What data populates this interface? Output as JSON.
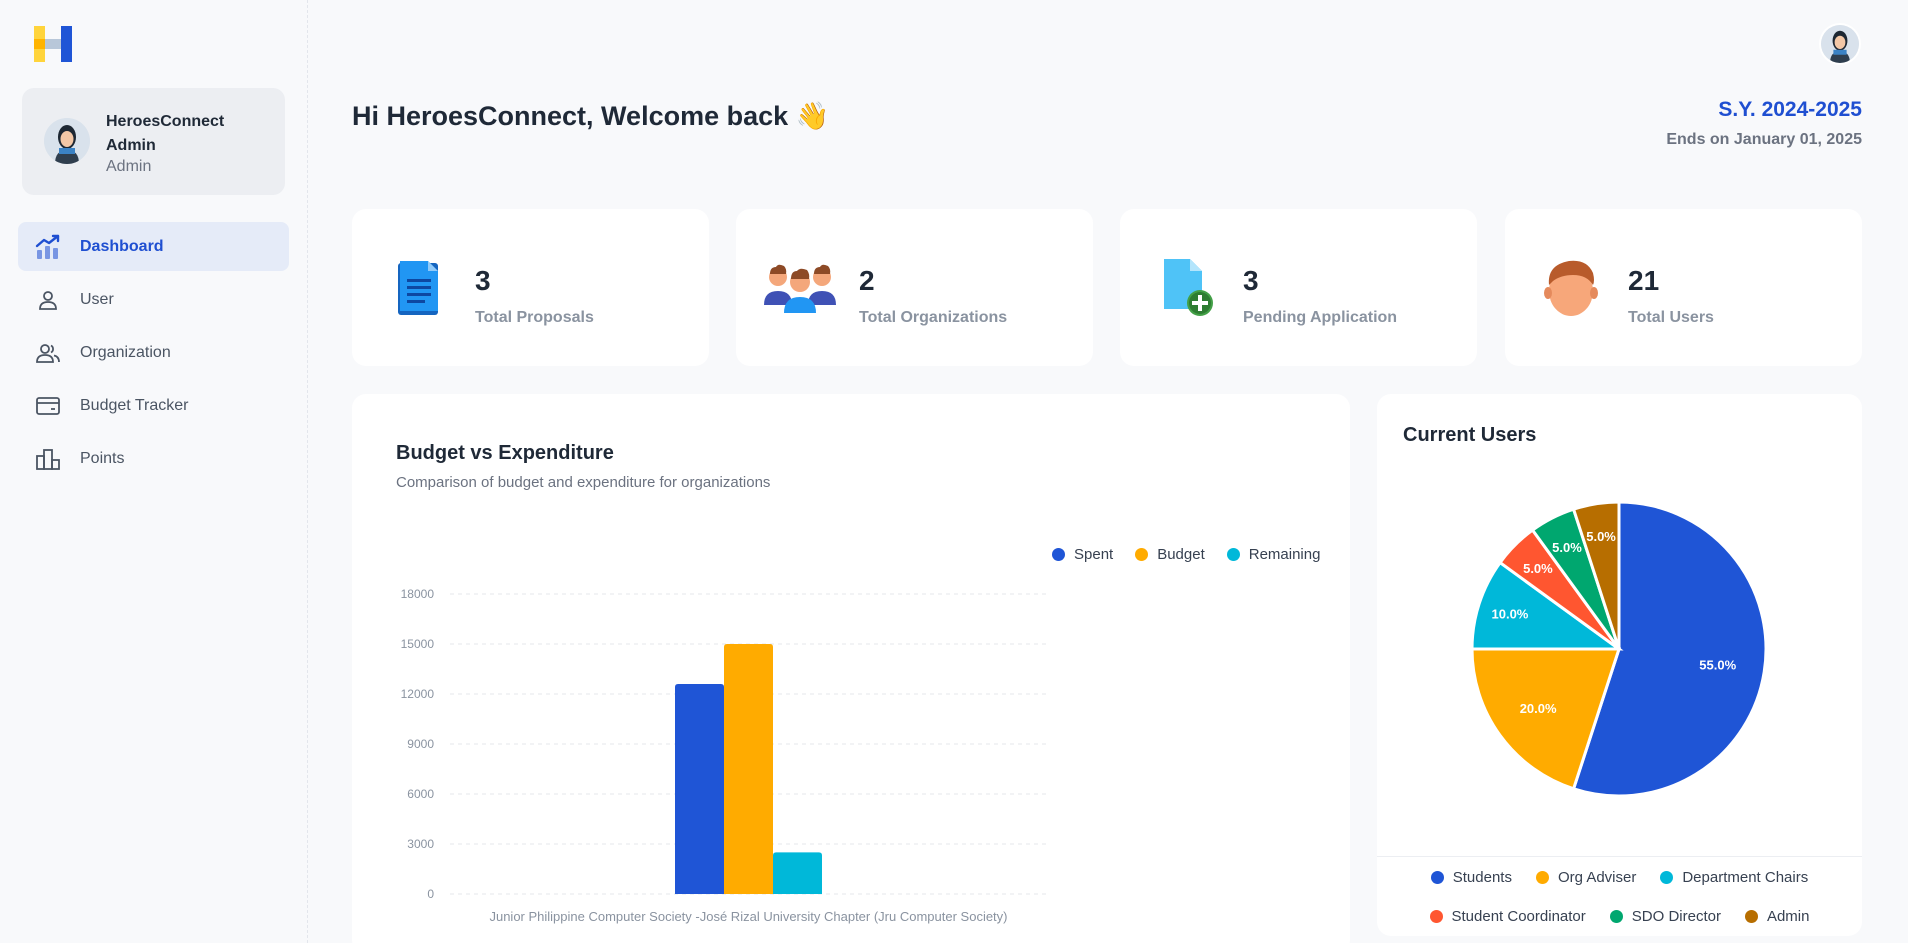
{
  "app": {
    "name": "HeroesConnect"
  },
  "profile": {
    "name": "HeroesConnect Admin",
    "role": "Admin"
  },
  "sidebar": {
    "items": [
      {
        "label": "Dashboard",
        "icon": "trending-chart-icon",
        "active": true
      },
      {
        "label": "User",
        "icon": "user-icon",
        "active": false
      },
      {
        "label": "Organization",
        "icon": "people-icon",
        "active": false
      },
      {
        "label": "Budget Tracker",
        "icon": "wallet-icon",
        "active": false
      },
      {
        "label": "Points",
        "icon": "podium-icon",
        "active": false
      }
    ]
  },
  "header": {
    "welcome": "Hi HeroesConnect, Welcome back 👋",
    "school_year": "S.Y. 2024-2025",
    "ends_on": "Ends on January 01, 2025"
  },
  "stats": [
    {
      "value": "3",
      "label": "Total Proposals",
      "icon": "document-icon"
    },
    {
      "value": "2",
      "label": "Total Organizations",
      "icon": "group-icon"
    },
    {
      "value": "3",
      "label": "Pending Application",
      "icon": "new-file-icon"
    },
    {
      "value": "21",
      "label": "Total Users",
      "icon": "face-icon"
    }
  ],
  "budget_panel": {
    "title": "Budget vs Expenditure",
    "subtitle": "Comparison of budget and expenditure for organizations"
  },
  "users_panel": {
    "title": "Current Users"
  },
  "colors": {
    "primary": "#1f4fd1",
    "spent": "#1f55d6",
    "budget": "#ffab00",
    "remaining": "#00b8d9"
  },
  "chart_data": [
    {
      "type": "bar",
      "title": "Budget vs Expenditure",
      "subtitle": "Comparison of budget and expenditure for organizations",
      "categories": [
        "Junior Philippine Computer Society -José Rizal University Chapter (Jru Computer Society)"
      ],
      "series": [
        {
          "name": "Spent",
          "color": "#1f55d6",
          "values": [
            12600
          ]
        },
        {
          "name": "Budget",
          "color": "#ffab00",
          "values": [
            15000
          ]
        },
        {
          "name": "Remaining",
          "color": "#00b8d9",
          "values": [
            2500
          ]
        }
      ],
      "yticks": [
        0,
        3000,
        6000,
        9000,
        12000,
        15000,
        18000
      ],
      "ylim": [
        0,
        18000
      ],
      "grid": true,
      "legend": "top-right"
    },
    {
      "type": "pie",
      "title": "Current Users",
      "labels": [
        "Students",
        "Org Adviser",
        "Department Chairs",
        "Student Coordinator",
        "SDO Director",
        "Admin"
      ],
      "values": [
        55.0,
        20.0,
        10.0,
        5.0,
        5.0,
        5.0
      ],
      "value_labels": [
        "55.0%",
        "20.0%",
        "10.0%",
        "5.0%",
        "5.0%",
        "5.0%"
      ],
      "colors": [
        "#1f55d6",
        "#ffab00",
        "#00b8d9",
        "#ff5630",
        "#00a76f",
        "#b76e00"
      ],
      "legend": "bottom"
    }
  ]
}
